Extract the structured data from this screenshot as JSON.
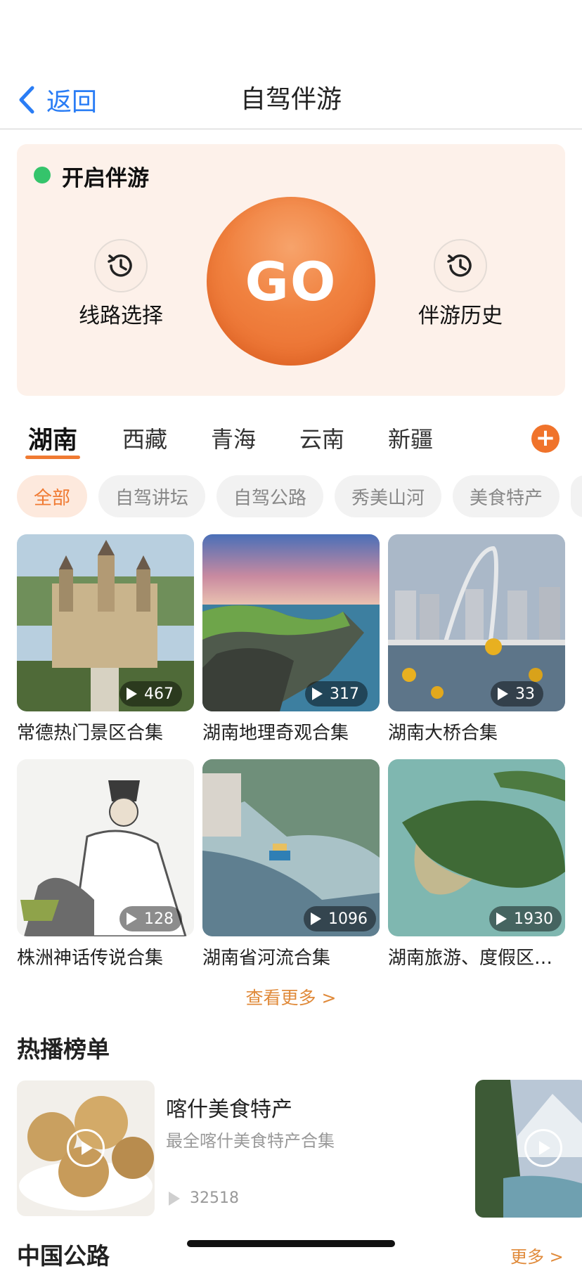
{
  "header": {
    "back_label": "返回",
    "title": "自驾伴游"
  },
  "start_card": {
    "status_label": "开启伴游",
    "route_label": "线路选择",
    "go_label": "GO",
    "history_label": "伴游历史"
  },
  "province_tabs": [
    "湖南",
    "西藏",
    "青海",
    "云南",
    "新疆"
  ],
  "add_label": "+",
  "categories": [
    "全部",
    "自驾讲坛",
    "自驾公路",
    "秀美山河",
    "美食特产"
  ],
  "collections": [
    {
      "title": "常德热门景区合集",
      "count": "467"
    },
    {
      "title": "湖南地理奇观合集",
      "count": "317"
    },
    {
      "title": "湖南大桥合集",
      "count": "33"
    },
    {
      "title": "株洲神话传说合集",
      "count": "128"
    },
    {
      "title": "湖南省河流合集",
      "count": "1096"
    },
    {
      "title": "湖南旅游、度假区…",
      "count": "1930"
    }
  ],
  "more_link": "查看更多 >",
  "hot": {
    "section_title": "热播榜单",
    "item": {
      "title": "喀什美食特产",
      "subtitle": "最全喀什美食特产合集",
      "plays": "32518"
    }
  },
  "highway": {
    "section_title": "中国公路",
    "more_label": "更多 >"
  },
  "colors": {
    "accent": "#f0732b",
    "link_blue": "#2a7df5",
    "status_green": "#35c46b"
  }
}
